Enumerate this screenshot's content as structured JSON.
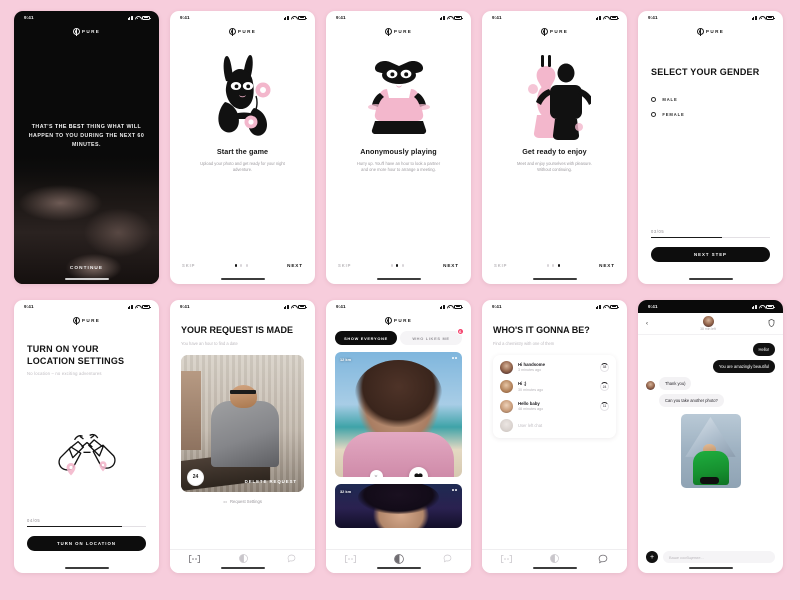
{
  "app": {
    "name": "PURE",
    "status_time": "9:41"
  },
  "screens": {
    "intro": {
      "headline_pre": "THAT'S ",
      "headline_em": "THE BEST",
      "headline_post": " THING WHAT WILL HAPPEN TO YOU DURING THE NEXT 60 MINUTES.",
      "cta": "CONTINUE"
    },
    "onboarding": [
      {
        "title": "Start the game",
        "subtitle": "Upload your photo and get ready for your night adventure.",
        "skip": "SKIP",
        "next": "NEXT",
        "active_dot": 0
      },
      {
        "title": "Anonymously playing",
        "subtitle": "Hurry up. You'll have an hour to look a partner and one more hour to arrange a meeting.",
        "skip": "SKIP",
        "next": "NEXT",
        "active_dot": 1
      },
      {
        "title": "Get ready to enjoy",
        "subtitle": "Meet and enjoy yourselves with pleasure. Without continuing.",
        "skip": "SKIP",
        "next": "NEXT",
        "active_dot": 2
      }
    ],
    "gender": {
      "title": "SELECT YOUR GENDER",
      "options": [
        {
          "label": "MALE",
          "selected": false
        },
        {
          "label": "FEMALE",
          "selected": false
        }
      ],
      "progress_label": "03/05",
      "progress_percent": 60,
      "cta": "NEXT STEP"
    },
    "location": {
      "title": "TURN ON YOUR LOCATION SETTINGS",
      "subtitle": "No location – no exciting adventures",
      "progress_label": "04/05",
      "progress_percent": 80,
      "cta": "TURN ON LOCATION"
    },
    "request": {
      "title": "YOUR REQUEST IS MADE",
      "subtitle": "You have an hour to find a date",
      "timer": "24",
      "delete_label": "DELETE REQUEST",
      "settings_label": "Request Settings",
      "settings_icon": "sliders-icon"
    },
    "feed": {
      "tabs": [
        {
          "label": "SHOW EVERYONE",
          "active": true
        },
        {
          "label": "WHO LIKES ME",
          "active": false,
          "badge": "6"
        }
      ],
      "cards": [
        {
          "distance": "12 km"
        },
        {
          "distance": "32 km"
        }
      ],
      "skip_icon": "close-icon",
      "like_icon": "heart-icon"
    },
    "chat_list": {
      "title": "WHO'S IT GONNA BE?",
      "subtitle": "Find a chemistry with one of them",
      "items": [
        {
          "name": "Hi handsome",
          "time": "3 minutes ago",
          "timer": "38"
        },
        {
          "name": "Hi ;)",
          "time": "30 minutes ago",
          "timer": "24"
        },
        {
          "name": "Hello baby",
          "time": "48 minutes ago",
          "timer": "11"
        },
        {
          "name": "User left chat",
          "time": "",
          "timer": "",
          "muted": true
        }
      ]
    },
    "chat_detail": {
      "back_icon": "chevron-left-icon",
      "shield_icon": "shield-icon",
      "time_left": "38 min left",
      "messages": [
        {
          "from": "me",
          "text": "Hello!"
        },
        {
          "from": "me",
          "text": "You are amazingly beautiful"
        },
        {
          "from": "them",
          "text": "Thank you)"
        },
        {
          "from": "them",
          "text": "Can you take another photo?"
        }
      ],
      "attach_icon": "plus-icon",
      "input_placeholder": "Ваше сообщение..."
    }
  },
  "tabbar": {
    "items": [
      {
        "icon": "card-bracket-icon",
        "name": "requests"
      },
      {
        "icon": "pure-logo-icon",
        "name": "feed"
      },
      {
        "icon": "chat-bubble-icon",
        "name": "chats"
      }
    ]
  },
  "theme": {
    "background": "#f7cddc",
    "ink": "#111111",
    "muted": "#bdbabf",
    "badge": "#f4426c",
    "accent_pink": "#e8a9c0"
  }
}
